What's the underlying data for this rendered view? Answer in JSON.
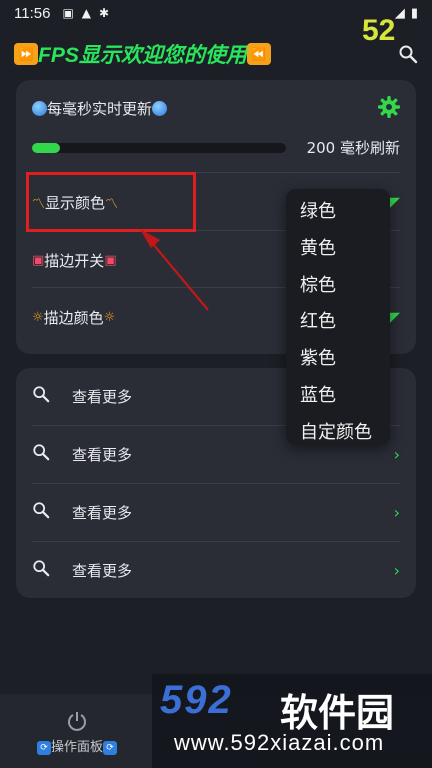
{
  "status_bar": {
    "time": "11:56"
  },
  "fps": "52",
  "header": {
    "title": "FPS显示欢迎您的使用"
  },
  "card1": {
    "update_label": "每毫秒实时更新",
    "refresh_label": "200 毫秒刷新",
    "refresh_progress": 0.11,
    "display_color_label": "显示颜色",
    "stroke_toggle_label": "描边开关",
    "stroke_color_label": "描边颜色"
  },
  "card2": {
    "items": [
      {
        "label": "查看更多"
      },
      {
        "label": "查看更多"
      },
      {
        "label": "查看更多"
      },
      {
        "label": "查看更多"
      }
    ]
  },
  "dropdown": {
    "options": [
      "绿色",
      "黄色",
      "棕色",
      "红色",
      "紫色",
      "蓝色",
      "自定颜色"
    ]
  },
  "bottom_nav": {
    "item_label": "操作面板"
  },
  "watermark": {
    "logo": "592",
    "name": "软件园",
    "url": "www.592xiazai.com"
  },
  "colors": {
    "accent": "#32d74b",
    "title": "#28e55c",
    "fps": "#d8e63b",
    "annotation": "#e02020"
  }
}
